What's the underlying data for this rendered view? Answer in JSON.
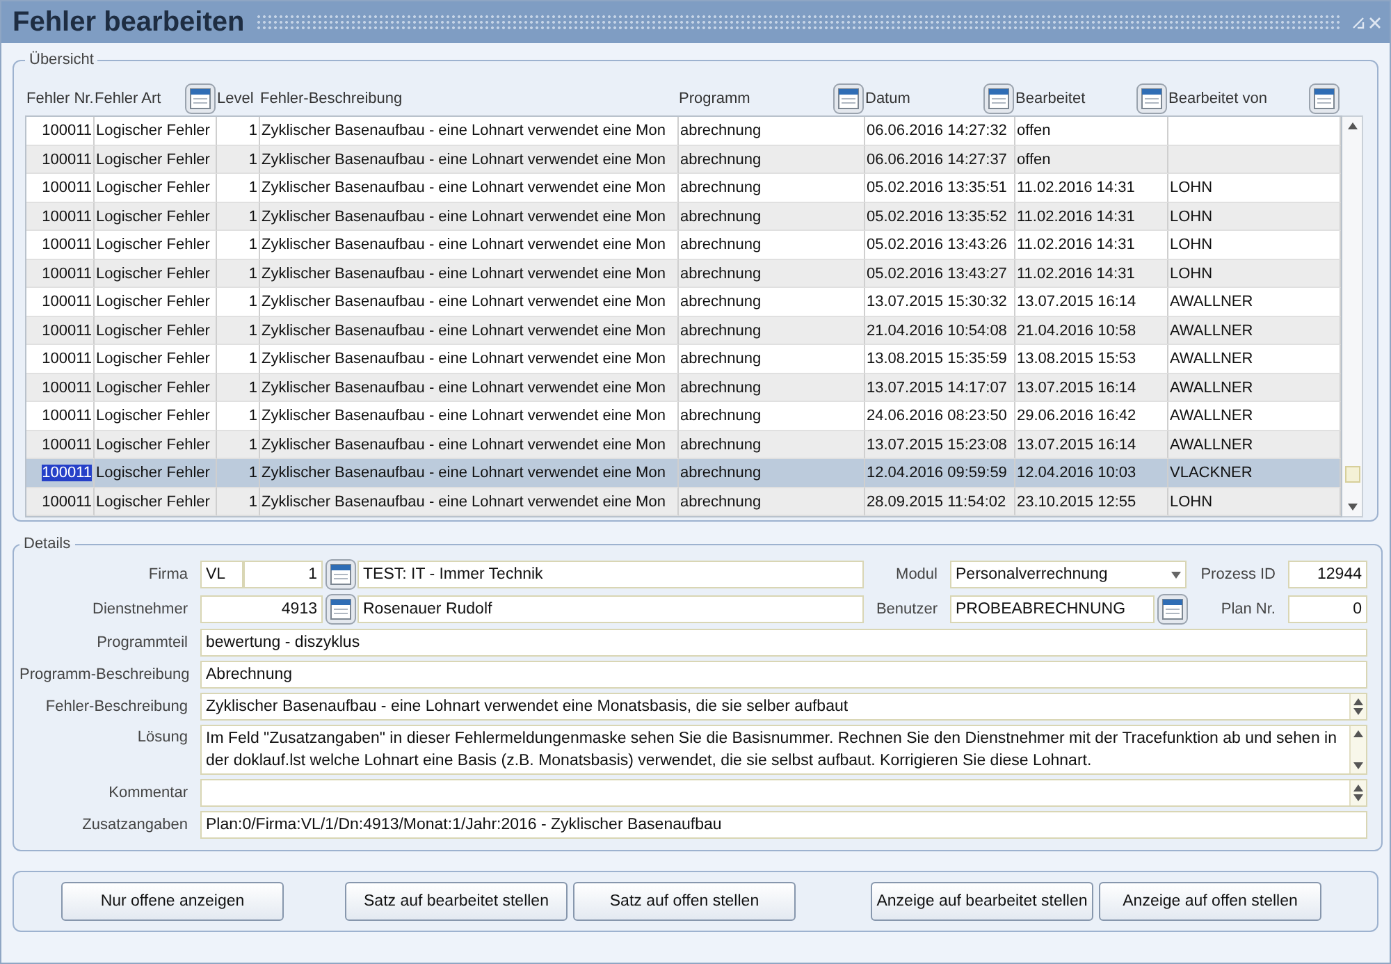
{
  "window": {
    "title": "Fehler bearbeiten"
  },
  "overview": {
    "legend": "Übersicht",
    "columns": [
      {
        "label": "Fehler Nr.",
        "lookup": false
      },
      {
        "label": "Fehler Art",
        "lookup": true
      },
      {
        "label": "Level",
        "lookup": false
      },
      {
        "label": "Fehler-Beschreibung",
        "lookup": false
      },
      {
        "label": "Programm",
        "lookup": true
      },
      {
        "label": "Datum",
        "lookup": true
      },
      {
        "label": "Bearbeitet",
        "lookup": true
      },
      {
        "label": "Bearbeitet von",
        "lookup": true
      }
    ],
    "rows": [
      {
        "cells": [
          "100011",
          "Logischer Fehler",
          "1",
          "Zyklischer Basenaufbau - eine Lohnart verwendet eine Mon",
          "abrechnung",
          "06.06.2016 14:27:32",
          "offen",
          ""
        ],
        "selected": false
      },
      {
        "cells": [
          "100011",
          "Logischer Fehler",
          "1",
          "Zyklischer Basenaufbau - eine Lohnart verwendet eine Mon",
          "abrechnung",
          "06.06.2016 14:27:37",
          "offen",
          ""
        ],
        "selected": false
      },
      {
        "cells": [
          "100011",
          "Logischer Fehler",
          "1",
          "Zyklischer Basenaufbau - eine Lohnart verwendet eine Mon",
          "abrechnung",
          "05.02.2016 13:35:51",
          "11.02.2016 14:31",
          "LOHN"
        ],
        "selected": false
      },
      {
        "cells": [
          "100011",
          "Logischer Fehler",
          "1",
          "Zyklischer Basenaufbau - eine Lohnart verwendet eine Mon",
          "abrechnung",
          "05.02.2016 13:35:52",
          "11.02.2016 14:31",
          "LOHN"
        ],
        "selected": false
      },
      {
        "cells": [
          "100011",
          "Logischer Fehler",
          "1",
          "Zyklischer Basenaufbau - eine Lohnart verwendet eine Mon",
          "abrechnung",
          "05.02.2016 13:43:26",
          "11.02.2016 14:31",
          "LOHN"
        ],
        "selected": false
      },
      {
        "cells": [
          "100011",
          "Logischer Fehler",
          "1",
          "Zyklischer Basenaufbau - eine Lohnart verwendet eine Mon",
          "abrechnung",
          "05.02.2016 13:43:27",
          "11.02.2016 14:31",
          "LOHN"
        ],
        "selected": false
      },
      {
        "cells": [
          "100011",
          "Logischer Fehler",
          "1",
          "Zyklischer Basenaufbau - eine Lohnart verwendet eine Mon",
          "abrechnung",
          "13.07.2015 15:30:32",
          "13.07.2015 16:14",
          "AWALLNER"
        ],
        "selected": false
      },
      {
        "cells": [
          "100011",
          "Logischer Fehler",
          "1",
          "Zyklischer Basenaufbau - eine Lohnart verwendet eine Mon",
          "abrechnung",
          "21.04.2016 10:54:08",
          "21.04.2016 10:58",
          "AWALLNER"
        ],
        "selected": false
      },
      {
        "cells": [
          "100011",
          "Logischer Fehler",
          "1",
          "Zyklischer Basenaufbau - eine Lohnart verwendet eine Mon",
          "abrechnung",
          "13.08.2015 15:35:59",
          "13.08.2015 15:53",
          "AWALLNER"
        ],
        "selected": false
      },
      {
        "cells": [
          "100011",
          "Logischer Fehler",
          "1",
          "Zyklischer Basenaufbau - eine Lohnart verwendet eine Mon",
          "abrechnung",
          "13.07.2015 14:17:07",
          "13.07.2015 16:14",
          "AWALLNER"
        ],
        "selected": false
      },
      {
        "cells": [
          "100011",
          "Logischer Fehler",
          "1",
          "Zyklischer Basenaufbau - eine Lohnart verwendet eine Mon",
          "abrechnung",
          "24.06.2016 08:23:50",
          "29.06.2016 16:42",
          "AWALLNER"
        ],
        "selected": false
      },
      {
        "cells": [
          "100011",
          "Logischer Fehler",
          "1",
          "Zyklischer Basenaufbau - eine Lohnart verwendet eine Mon",
          "abrechnung",
          "13.07.2015 15:23:08",
          "13.07.2015 16:14",
          "AWALLNER"
        ],
        "selected": false
      },
      {
        "cells": [
          "100011",
          "Logischer Fehler",
          "1",
          "Zyklischer Basenaufbau - eine Lohnart verwendet eine Mon",
          "abrechnung",
          "12.04.2016 09:59:59",
          "12.04.2016 10:03",
          "VLACKNER"
        ],
        "selected": true
      },
      {
        "cells": [
          "100011",
          "Logischer Fehler",
          "1",
          "Zyklischer Basenaufbau - eine Lohnart verwendet eine Mon",
          "abrechnung",
          "28.09.2015 11:54:02",
          "23.10.2015 12:55",
          "LOHN"
        ],
        "selected": false
      }
    ]
  },
  "details": {
    "legend": "Details",
    "firma": {
      "label": "Firma",
      "code": "VL",
      "number": "1",
      "name": "TEST: IT - Immer Technik"
    },
    "modul": {
      "label": "Modul",
      "value": "Personalverrechnung"
    },
    "prozess_id": {
      "label": "Prozess ID",
      "value": "12944"
    },
    "dienstnehmer": {
      "label": "Dienstnehmer",
      "number": "4913",
      "name": "Rosenauer Rudolf"
    },
    "benutzer": {
      "label": "Benutzer",
      "value": "PROBEABRECHNUNG"
    },
    "plan_nr": {
      "label": "Plan Nr.",
      "value": "0"
    },
    "fields": [
      {
        "label": "Programmteil",
        "kind": "text",
        "value": "bewertung - diszyklus"
      },
      {
        "label": "Programm-Beschreibung",
        "kind": "text",
        "value": "Abrechnung"
      },
      {
        "label": "Fehler-Beschreibung",
        "kind": "scroll",
        "value": "Zyklischer Basenaufbau - eine Lohnart verwendet eine Monatsbasis, die sie selber aufbaut"
      },
      {
        "label": "Lösung",
        "kind": "textarea",
        "value": "Im Feld \"Zusatzangaben\" in dieser Fehlermeldungenmaske sehen Sie die Basisnummer. Rechnen Sie den Dienstnehmer mit der Tracefunktion ab und sehen in der doklauf.lst welche Lohnart eine Basis (z.B. Monatsbasis) verwendet, die sie selbst aufbaut. Korrigieren Sie diese Lohnart."
      },
      {
        "label": "Kommentar",
        "kind": "scroll"
      },
      {
        "label": "Zusatzangaben",
        "kind": "text",
        "value": "Plan:0/Firma:VL/1/Dn:4913/Monat:1/Jahr:2016 - Zyklischer Basenaufbau"
      }
    ]
  },
  "button_groups": [
    [
      "Nur offene anzeigen"
    ],
    [
      "Satz auf bearbeitet stellen",
      "Satz auf offen stellen"
    ],
    [
      "Anzeige auf bearbeitet stellen",
      "Anzeige auf offen stellen"
    ]
  ]
}
